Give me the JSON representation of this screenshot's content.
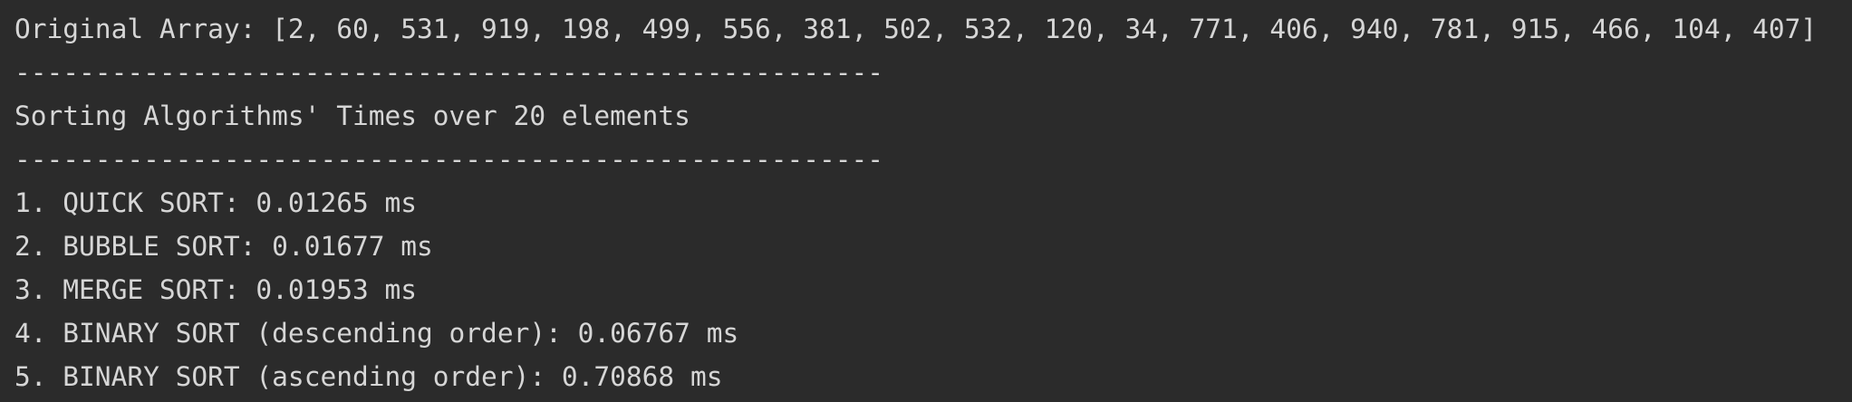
{
  "console": {
    "lines": [
      "Original Array: [2, 60, 531, 919, 198, 499, 556, 381, 502, 532, 120, 34, 771, 406, 940, 781, 915, 466, 104, 407]",
      "------------------------------------------------------",
      "Sorting Algorithms' Times over 20 elements",
      "------------------------------------------------------",
      "1. QUICK SORT: 0.01265 ms",
      "2. BUBBLE SORT: 0.01677 ms",
      "3. MERGE SORT: 0.01953 ms",
      "4. BINARY SORT (descending order): 0.06767 ms",
      "5. BINARY SORT (ascending order): 0.70868 ms"
    ]
  }
}
